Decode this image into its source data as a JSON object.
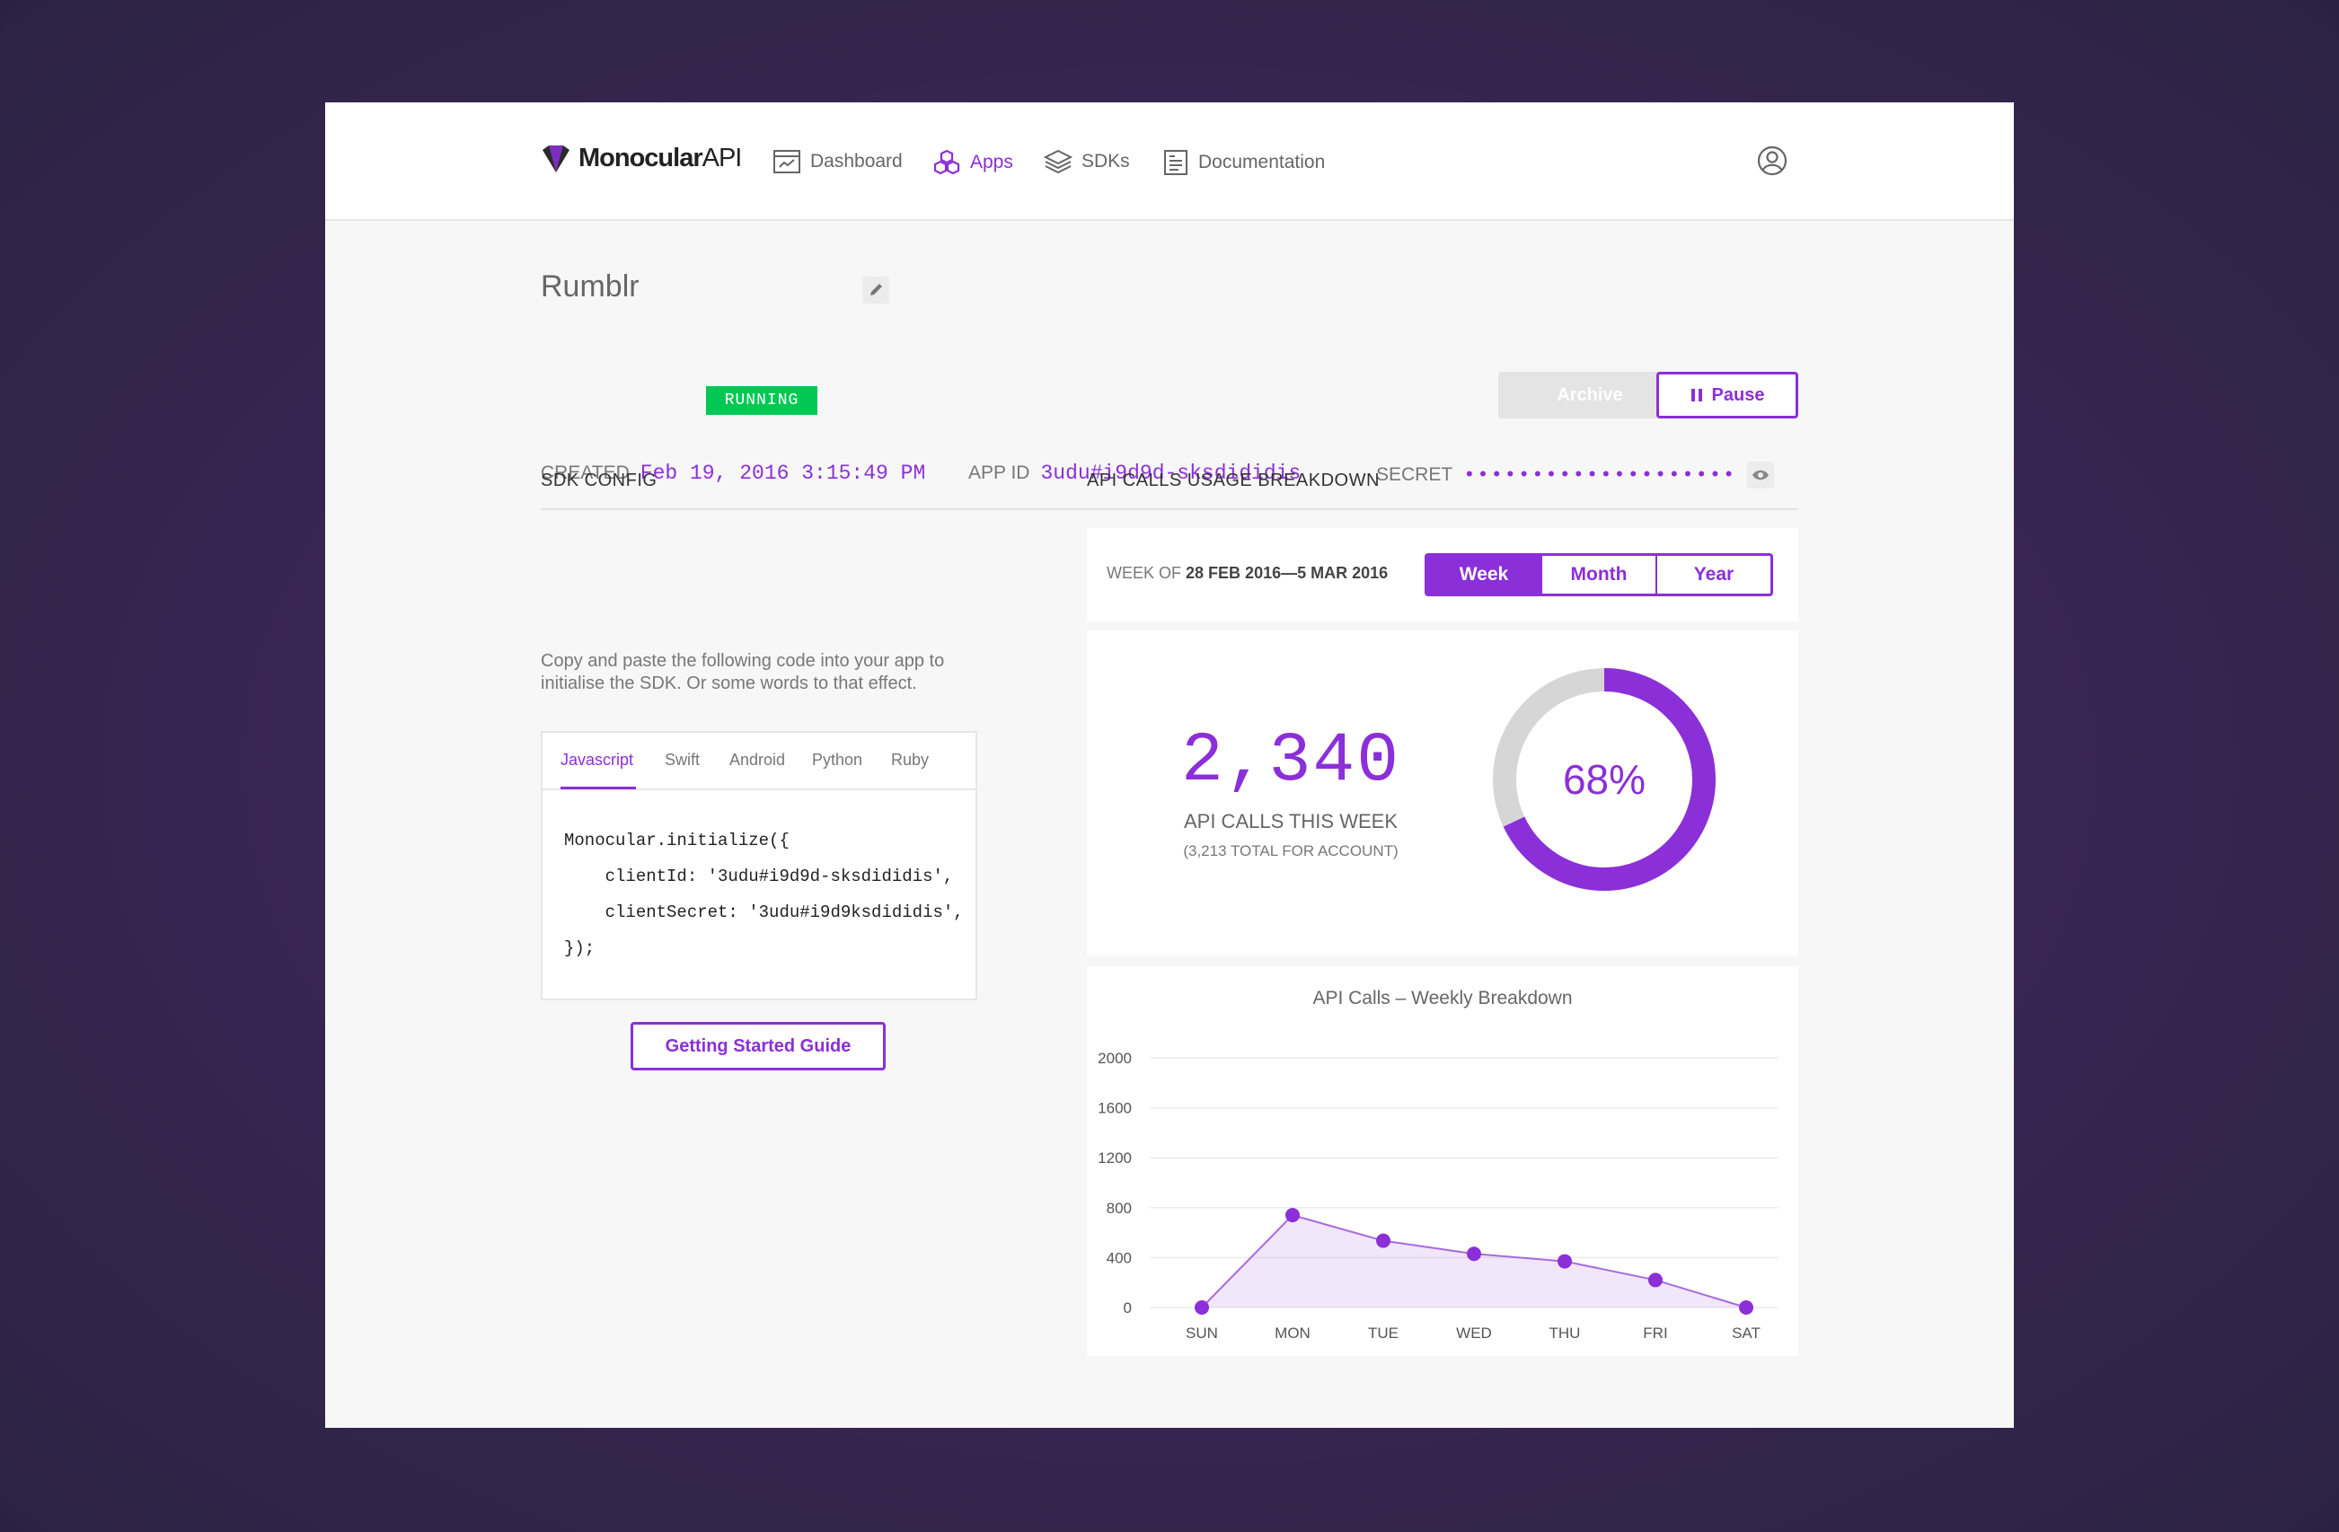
{
  "brand": {
    "name_bold": "Monocular",
    "name_light": "API"
  },
  "nav": [
    {
      "label": "Dashboard",
      "icon": "dashboard-icon",
      "active": false
    },
    {
      "label": "Apps",
      "icon": "apps-icon",
      "active": true
    },
    {
      "label": "SDKs",
      "icon": "sdks-icon",
      "active": false
    },
    {
      "label": "Documentation",
      "icon": "documentation-icon",
      "active": false
    }
  ],
  "app": {
    "name": "Rumblr",
    "status": "RUNNING"
  },
  "actions": {
    "archive": "Archive",
    "pause": "Pause"
  },
  "meta": {
    "created_label": "CREATED",
    "created_value": "Feb 19, 2016 3:15:49 PM",
    "appid_label": "APP ID",
    "appid_value": "3udu#i9d9d-sksdididis",
    "secret_label": "SECRET",
    "secret_value": "••••••••••••••••••••"
  },
  "sdk": {
    "heading": "SDK CONFIG",
    "description": "Copy and paste the following code into your app to initialise the SDK. Or some words to that effect.",
    "tabs": [
      "Javascript",
      "Swift",
      "Android",
      "Python",
      "Ruby"
    ],
    "active_tab": "Javascript",
    "code": "Monocular.initialize({\n    clientId: '3udu#i9d9d-sksdididis',\n    clientSecret: '3udu#i9d9ksdididis',\n});",
    "guide_button": "Getting Started Guide"
  },
  "usage": {
    "heading": "API CALLS USAGE BREAKDOWN",
    "week_prefix": "WEEK OF",
    "week_range": "28 FEB 2016—5 MAR 2016",
    "periods": [
      "Week",
      "Month",
      "Year"
    ],
    "active_period": "Week",
    "calls": "2,340",
    "calls_label": "API CALLS THIS WEEK",
    "total_label": "(3,213 TOTAL FOR ACCOUNT)",
    "percent_label": "68%",
    "percent_value": 0.68
  },
  "colors": {
    "accent": "#8b2fd8",
    "running": "#00c853",
    "donut_track": "#d6d6d6"
  },
  "chart_data": {
    "type": "area",
    "title": "API Calls – Weekly Breakdown",
    "categories": [
      "SUN",
      "MON",
      "TUE",
      "WED",
      "THU",
      "FRI",
      "SAT"
    ],
    "values": [
      0,
      740,
      535,
      430,
      370,
      220,
      0
    ],
    "y_ticks": [
      0,
      400,
      800,
      1200,
      1600,
      2000
    ],
    "ylim": [
      0,
      2000
    ],
    "grid": true,
    "xlabel": "",
    "ylabel": ""
  }
}
